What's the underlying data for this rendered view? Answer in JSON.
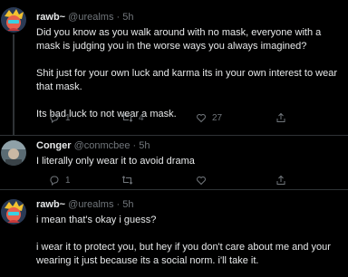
{
  "tweets": [
    {
      "name": "rawb~",
      "handle": "@urealms",
      "sep": "·",
      "time": "5h",
      "paragraphs": [
        "Did you know as you walk around with no mask, everyone with a mask is judging you in the worse ways you always imagined?",
        "Shit just for your own luck and karma its in your own interest to wear that mask.",
        "Its bad luck to not wear a mask."
      ],
      "reply_count": "1",
      "retweet_count": "4",
      "like_count": "27"
    },
    {
      "name": "Conger",
      "handle": "@conmcbee",
      "sep": "·",
      "time": "5h",
      "paragraphs": [
        "I literally only wear it to avoid drama"
      ],
      "reply_count": "1",
      "retweet_count": "",
      "like_count": ""
    },
    {
      "name": "rawb~",
      "handle": "@urealms",
      "sep": "·",
      "time": "5h",
      "paragraphs": [
        "i mean that's okay i guess?",
        "i wear it to protect you, but hey if you don't care about me and your wearing it just because its a social norm. i'll take it."
      ],
      "reply_count": "",
      "retweet_count": "",
      "like_count": ""
    }
  ],
  "icons": [
    "reply-icon",
    "retweet-icon",
    "like-icon",
    "share-icon"
  ],
  "colors": {
    "background": "#000000",
    "text": "#e7e9ea",
    "secondary": "#71767b",
    "border": "#2f3336"
  }
}
